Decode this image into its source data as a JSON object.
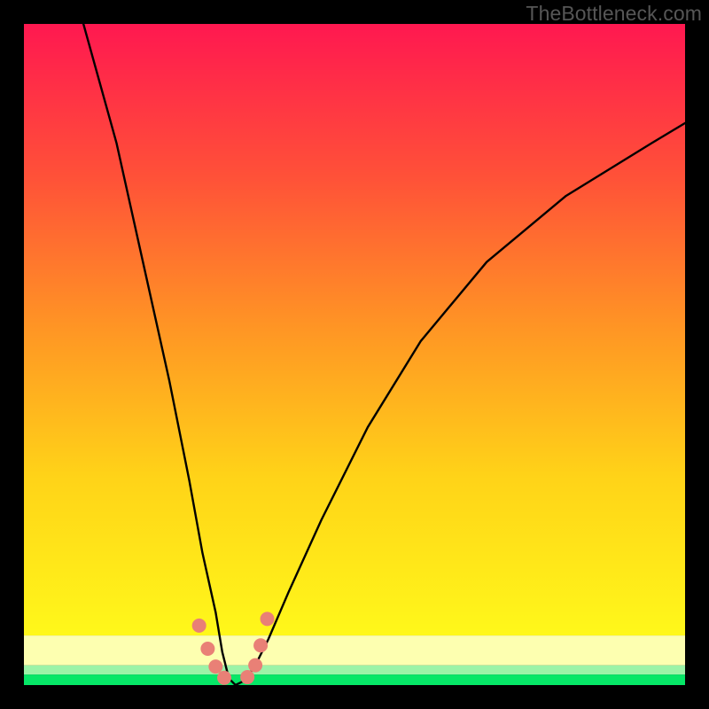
{
  "watermark": "TheBottleneck.com",
  "colors": {
    "grad_top": "#ff1850",
    "grad_q1": "#ff5138",
    "grad_mid": "#ff9624",
    "grad_q3": "#ffd318",
    "grad_low": "#fff81a",
    "band_pale_yellow": "#fdffb0",
    "band_mint": "#9bf3a7",
    "band_green": "#06e767",
    "curve": "#000000",
    "markers": "#e98076",
    "frame": "#000000"
  },
  "chart_data": {
    "type": "line",
    "title": "",
    "xlabel": "",
    "ylabel": "",
    "xlim": [
      0,
      100
    ],
    "ylim": [
      0,
      100
    ],
    "note": "Axes unlabeled; values are estimated relative to the plotting area (0–100) from the rendered curve and markers. The curve is a V-shaped well with minimum near x≈31–32. Left branch is steep and nearly vertical; right branch rises more gradually.",
    "series": [
      {
        "name": "curve",
        "x": [
          9,
          14,
          18,
          22,
          25,
          27,
          29,
          30,
          31,
          32,
          33,
          34,
          35,
          37,
          40,
          45,
          52,
          60,
          70,
          82,
          95,
          100
        ],
        "y": [
          100,
          82,
          64,
          46,
          31,
          20,
          11,
          5,
          1,
          0,
          0.5,
          1.5,
          3,
          7,
          14,
          25,
          39,
          52,
          64,
          74,
          82,
          85
        ]
      }
    ],
    "markers": [
      {
        "x": 26.5,
        "y": 9.0
      },
      {
        "x": 27.8,
        "y": 5.5
      },
      {
        "x": 29.0,
        "y": 2.8
      },
      {
        "x": 30.3,
        "y": 1.1
      },
      {
        "x": 33.8,
        "y": 1.2
      },
      {
        "x": 35.0,
        "y": 3.0
      },
      {
        "x": 35.8,
        "y": 6.0
      },
      {
        "x": 36.8,
        "y": 10.0
      }
    ],
    "bands_from_bottom_percent": [
      {
        "color_key": "band_green",
        "height": 1.6
      },
      {
        "color_key": "band_mint",
        "height": 1.4
      },
      {
        "color_key": "band_pale_yellow",
        "height": 4.5
      }
    ]
  }
}
